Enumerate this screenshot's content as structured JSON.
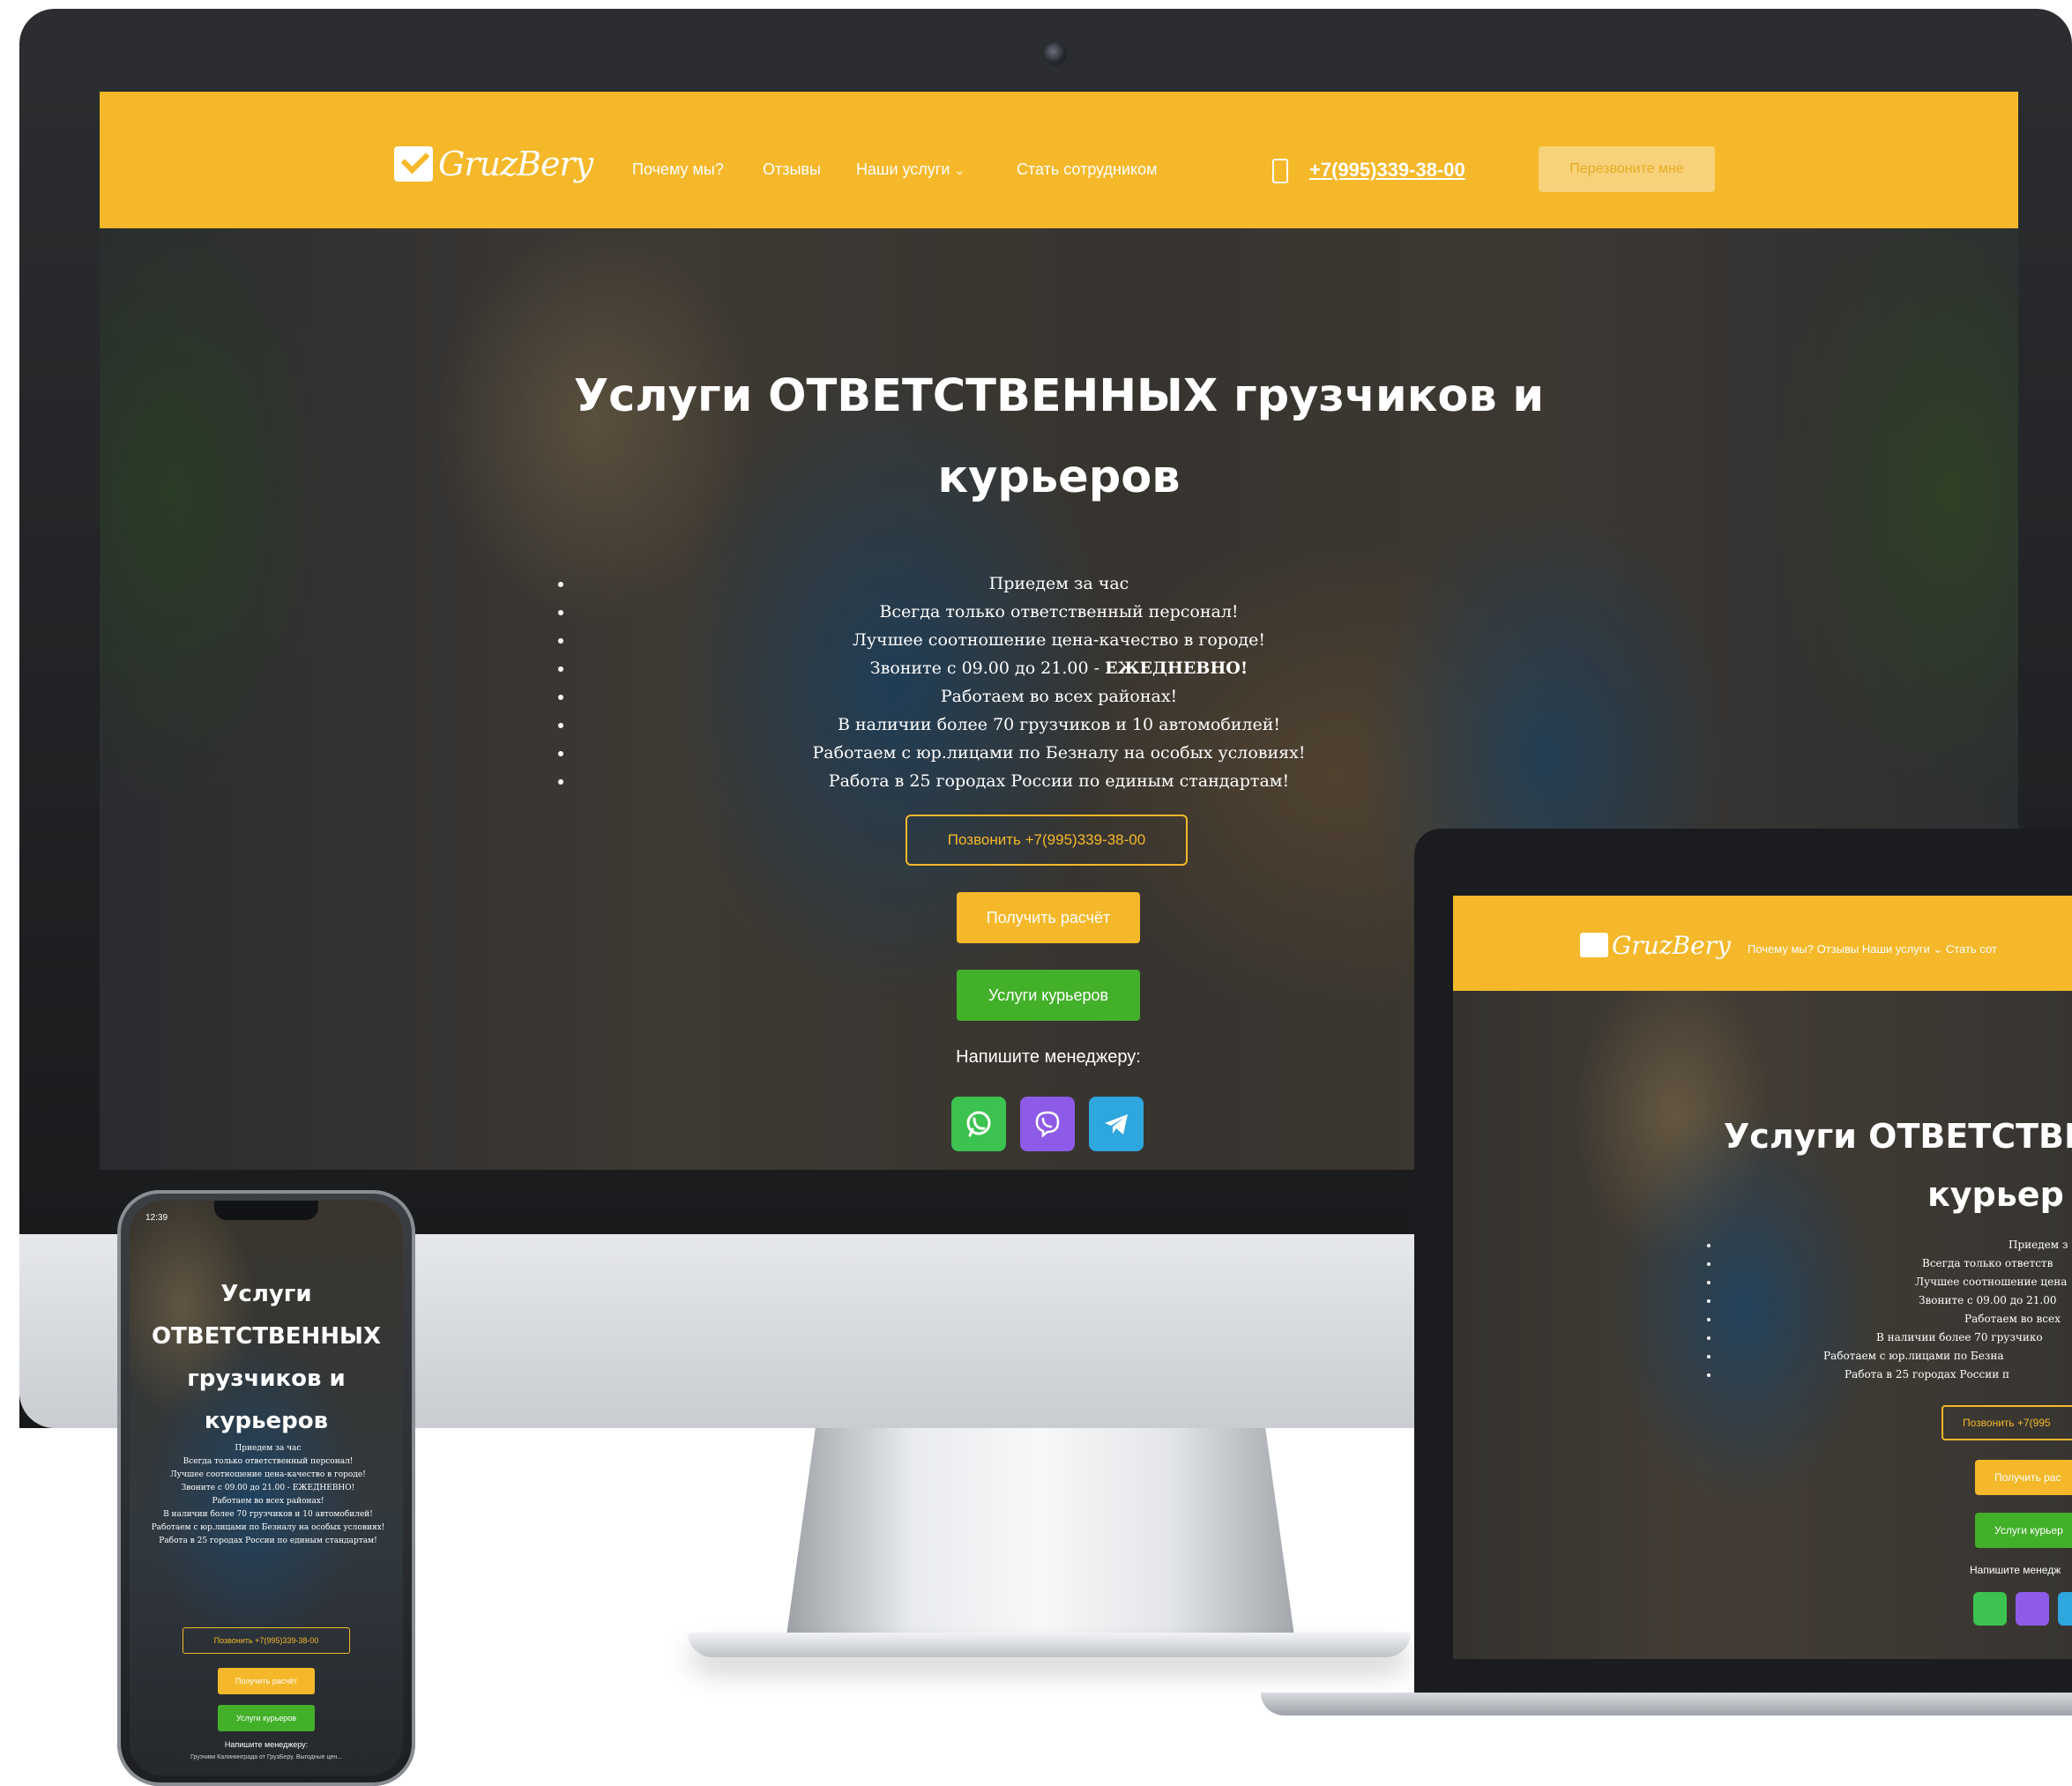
{
  "brand": {
    "logo_text": "GruzBery",
    "accent": "#f4b82a",
    "green": "#43b02a"
  },
  "nav": {
    "links": [
      "Почему мы?",
      "Отзывы",
      "Наши услуги",
      "Стать сотрудником"
    ],
    "dropdown_icon": "chevron-down-icon",
    "phone": "+7(995)339-38-00",
    "callback_label": "Перезвоните мне"
  },
  "hero": {
    "title_line1": "Услуги ОТВЕТСТВЕННЫХ грузчиков и",
    "title_line2": "курьеров",
    "bullets": [
      "Приедем за час",
      "Всегда только ответственный персонал!",
      "Лучшее соотношение цена-качество в городе!",
      "Звоните с 09.00 до 21.00 - ",
      "Работаем во всех районах!",
      "В наличии более 70 грузчиков и 10 автомобилей!",
      "Работаем с юр.лицами по Безналу на особых условиях!",
      "Работа в 25 городах России по единым стандартам!"
    ],
    "bullet4_bold": "ЕЖЕДНЕВНО!",
    "call_button": "Позвонить +7(995)339-38-00",
    "calc_button": "Получить расчёт",
    "couriers_button": "Услуги курьеров",
    "write_manager": "Напишите менеджеру:",
    "messengers": [
      {
        "name": "whatsapp-icon",
        "color": "#3cc24f"
      },
      {
        "name": "viber-icon",
        "color": "#8e5be8"
      },
      {
        "name": "telegram-icon",
        "color": "#2ea6de"
      }
    ]
  },
  "laptop": {
    "logo_text": "GruzBery",
    "nav_text": "Почему мы?   Отзывы   Наши услуги ⌄   Стать сот",
    "title_line1": "Услуги ОТВЕТСТВЕН",
    "title_line2": "курьер",
    "bullets": [
      "Приедем з",
      "Всегда только ответств",
      "Лучшее соотношение цена",
      "Звоните с 09.00 до 21.00",
      "Работаем во всех",
      "В наличии более 70 грузчико",
      "Работаем с юр.лицами по Безна",
      "Работа в 25 городах России п"
    ],
    "call_button": "Позвонить +7(995",
    "calc_button": "Получить рас",
    "couriers_button": "Услуги курьер",
    "write_manager": "Напишите менедж"
  },
  "phone": {
    "status_time": "12:39",
    "title": "Услуги ОТВЕТСТВЕННЫХ грузчиков и курьеров",
    "bullets": [
      "Приедем за час",
      "Всегда только ответственный персонал!",
      "Лучшее соотношение цена-качество в городе!",
      "Звоните с 09.00 до 21.00 - ЕЖЕДНЕВНО!",
      "Работаем во всех районах!",
      "В наличии более 70 грузчиков и 10 автомобилей!",
      "Работаем с юр.лицами по Безналу на особых условиях!",
      "Работа в 25 городах России по единым стандартам!"
    ],
    "call_button": "Позвонить +7(995)339-38-00",
    "calc_button": "Получить расчёт",
    "couriers_button": "Услуги курьеров",
    "write_manager": "Напишите менеджеру:",
    "footer": "Грузчики Калининграда от ГрузБеру. Выгодные цен..."
  }
}
